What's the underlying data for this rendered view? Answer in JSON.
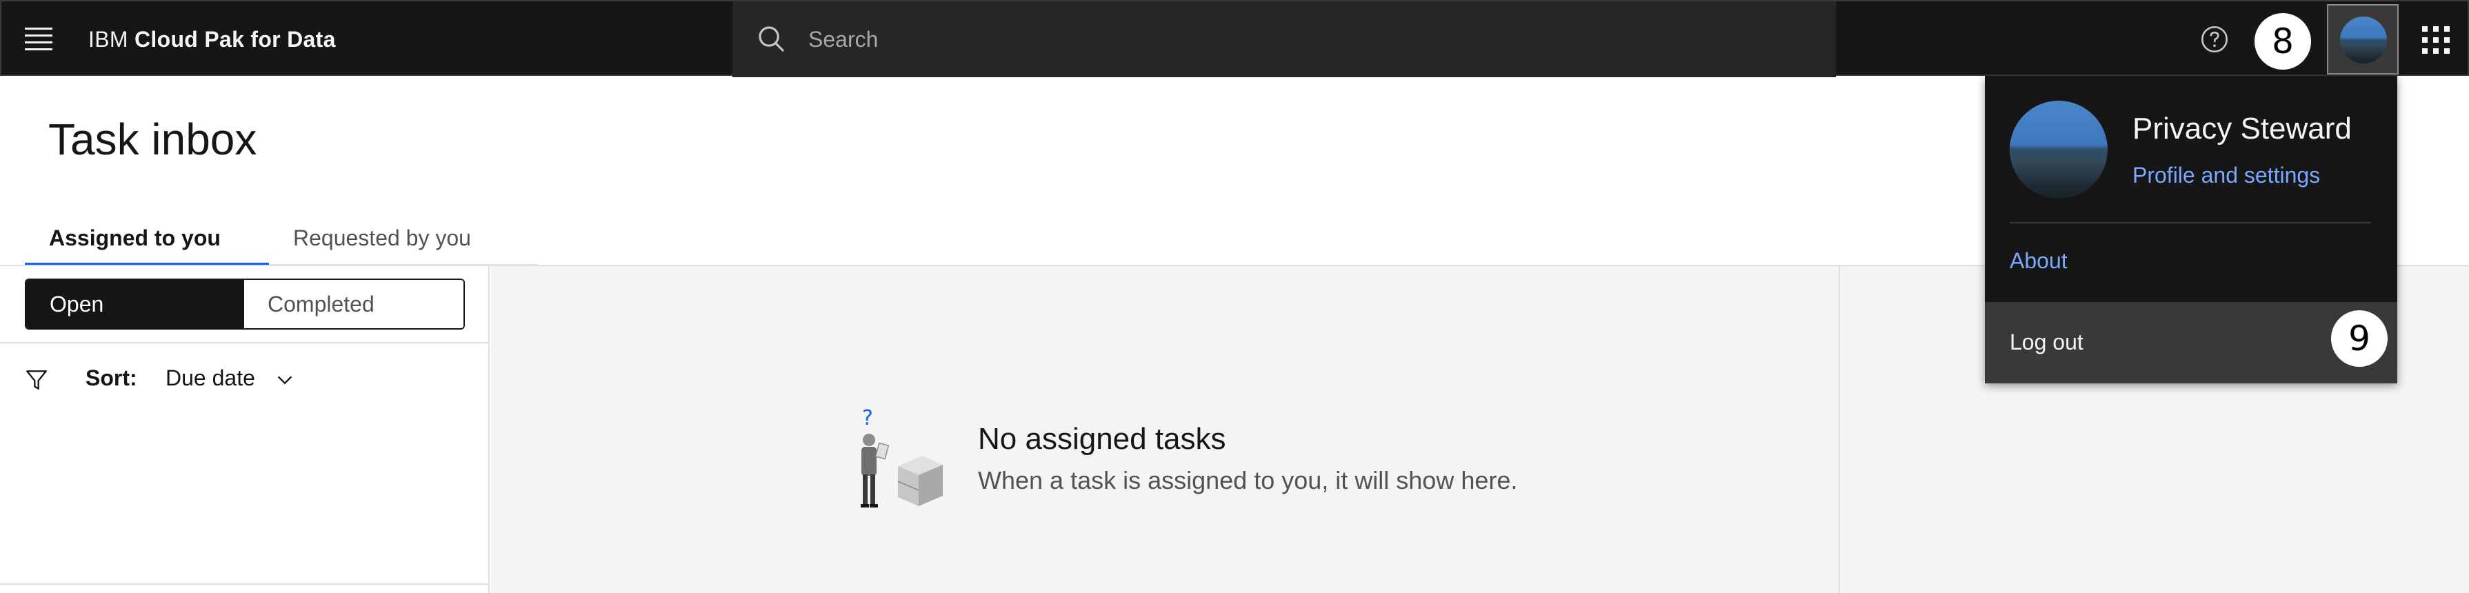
{
  "header": {
    "brand_prefix": "IBM",
    "brand_name": "Cloud Pak for Data",
    "search_placeholder": "Search",
    "step_badge": "8"
  },
  "page": {
    "title": "Task inbox",
    "tabs": [
      {
        "label": "Assigned to you",
        "active": true
      },
      {
        "label": "Requested by you",
        "active": false
      }
    ],
    "toggle": {
      "open": "Open",
      "completed": "Completed"
    },
    "sort": {
      "label": "Sort:",
      "value": "Due date"
    },
    "empty_state": {
      "title": "No assigned tasks",
      "subtitle": "When a task is assigned to you, it will show here."
    }
  },
  "user_menu": {
    "name": "Privacy Steward",
    "profile_link": "Profile and settings",
    "about": "About",
    "logout": "Log out",
    "step_badge": "9"
  },
  "colors": {
    "header_bg": "#161616",
    "link": "#78a9ff",
    "active_tab": "#0f62fe",
    "main_bg": "#f4f4f4"
  },
  "icons": [
    "menu-icon",
    "search-icon",
    "help-icon",
    "avatar",
    "app-switcher-icon",
    "filter-icon",
    "chevron-down-icon",
    "empty-state-illustration"
  ]
}
